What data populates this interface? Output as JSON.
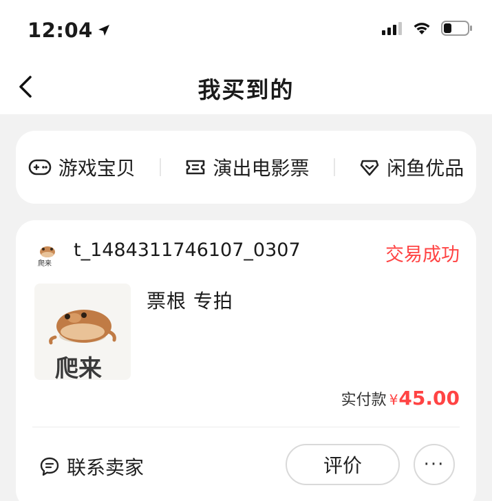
{
  "status_bar": {
    "time": "12:04"
  },
  "nav": {
    "title": "我买到的"
  },
  "categories": [
    {
      "label": "游戏宝贝",
      "icon": "gamepad-icon"
    },
    {
      "label": "演出电影票",
      "icon": "ticket-icon"
    },
    {
      "label": "闲鱼优品",
      "icon": "diamond-tag-icon"
    }
  ],
  "order": {
    "seller_name": "t_1484311746107_0307",
    "status": "交易成功",
    "product_title": "票根 专拍",
    "avatar_caption": "爬来",
    "image_caption": "爬来",
    "price_label": "实付款",
    "price_symbol": "¥",
    "price_value": "45.00",
    "contact_label": "联系卖家",
    "review_label": "评价",
    "more_label": "···"
  },
  "colors": {
    "accent_red": "#ff4444",
    "background": "#f2f2f2",
    "card": "#ffffff"
  }
}
